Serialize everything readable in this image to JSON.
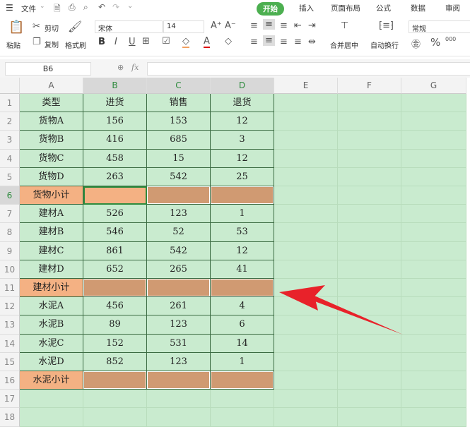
{
  "menu": {
    "file": "文件",
    "tabs": [
      "开始",
      "插入",
      "页面布局",
      "公式",
      "数据",
      "审阅"
    ],
    "active_tab": "开始"
  },
  "ribbon": {
    "paste": "粘贴",
    "cut": "剪切",
    "copy": "复制",
    "format_painter": "格式刷",
    "font_name": "宋体",
    "font_size": "14",
    "bold": "B",
    "italic": "I",
    "underline": "U",
    "merge_center": "合并居中",
    "wrap_text": "自动换行",
    "number_format": "常规",
    "percent": "%"
  },
  "formula_bar": {
    "name_box": "B6",
    "fx": "fx",
    "value": ""
  },
  "columns": [
    "A",
    "B",
    "C",
    "D",
    "E",
    "F",
    "G"
  ],
  "selected_cell": "B6",
  "rows": [
    [
      "类型",
      "进货",
      "销售",
      "退货"
    ],
    [
      "货物A",
      "156",
      "153",
      "12"
    ],
    [
      "货物B",
      "416",
      "685",
      "3"
    ],
    [
      "货物C",
      "458",
      "15",
      "12"
    ],
    [
      "货物D",
      "263",
      "542",
      "25"
    ],
    [
      "货物小计",
      "",
      "",
      ""
    ],
    [
      "建材A",
      "526",
      "123",
      "1"
    ],
    [
      "建材B",
      "546",
      "52",
      "53"
    ],
    [
      "建材C",
      "861",
      "542",
      "12"
    ],
    [
      "建材D",
      "652",
      "265",
      "41"
    ],
    [
      "建材小计",
      "",
      "",
      ""
    ],
    [
      "水泥A",
      "456",
      "261",
      "4"
    ],
    [
      "水泥B",
      "89",
      "123",
      "6"
    ],
    [
      "水泥C",
      "152",
      "531",
      "14"
    ],
    [
      "水泥D",
      "852",
      "123",
      "1"
    ],
    [
      "水泥小计",
      "",
      "",
      ""
    ],
    [
      "",
      "",
      "",
      ""
    ],
    [
      "",
      "",
      "",
      ""
    ]
  ],
  "colors": {
    "sheet_bg": "#c9ebcf",
    "subtotal_label": "#f4b183",
    "subtotal_fill": "#d09a72",
    "selected_fill": "#f4b183",
    "arrow": "#e8222a",
    "accent": "#4caf50"
  }
}
